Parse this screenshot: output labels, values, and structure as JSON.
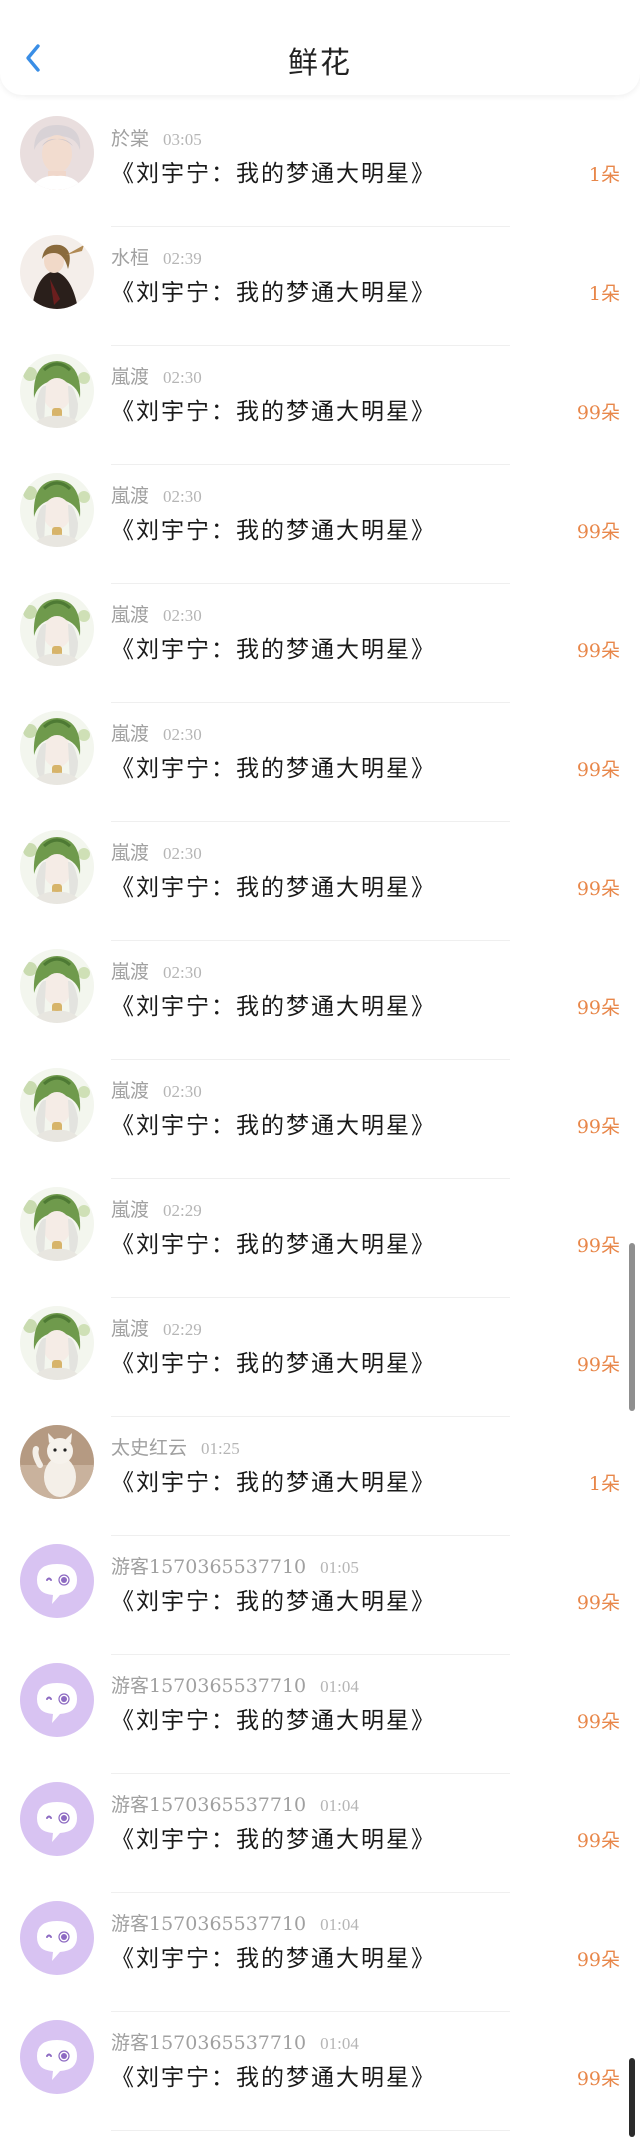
{
  "header": {
    "title": "鲜花"
  },
  "colors": {
    "accent": "#3a8ee6",
    "count": "#e8874a"
  },
  "items": [
    {
      "user": "於棠",
      "time": "03:05",
      "work": "《刘宇宁：我的梦通大明星》",
      "count": "1朵",
      "avatar": "portrait"
    },
    {
      "user": "水桓",
      "time": "02:39",
      "work": "《刘宇宁：我的梦通大明星》",
      "count": "1朵",
      "avatar": "dark-figure"
    },
    {
      "user": "嵐渡",
      "time": "02:30",
      "work": "《刘宇宁：我的梦通大明星》",
      "count": "99朵",
      "avatar": "green-hood"
    },
    {
      "user": "嵐渡",
      "time": "02:30",
      "work": "《刘宇宁：我的梦通大明星》",
      "count": "99朵",
      "avatar": "green-hood"
    },
    {
      "user": "嵐渡",
      "time": "02:30",
      "work": "《刘宇宁：我的梦通大明星》",
      "count": "99朵",
      "avatar": "green-hood"
    },
    {
      "user": "嵐渡",
      "time": "02:30",
      "work": "《刘宇宁：我的梦通大明星》",
      "count": "99朵",
      "avatar": "green-hood"
    },
    {
      "user": "嵐渡",
      "time": "02:30",
      "work": "《刘宇宁：我的梦通大明星》",
      "count": "99朵",
      "avatar": "green-hood"
    },
    {
      "user": "嵐渡",
      "time": "02:30",
      "work": "《刘宇宁：我的梦通大明星》",
      "count": "99朵",
      "avatar": "green-hood"
    },
    {
      "user": "嵐渡",
      "time": "02:30",
      "work": "《刘宇宁：我的梦通大明星》",
      "count": "99朵",
      "avatar": "green-hood"
    },
    {
      "user": "嵐渡",
      "time": "02:29",
      "work": "《刘宇宁：我的梦通大明星》",
      "count": "99朵",
      "avatar": "green-hood"
    },
    {
      "user": "嵐渡",
      "time": "02:29",
      "work": "《刘宇宁：我的梦通大明星》",
      "count": "99朵",
      "avatar": "green-hood"
    },
    {
      "user": "太史红云",
      "time": "01:25",
      "work": "《刘宇宁：我的梦通大明星》",
      "count": "1朵",
      "avatar": "cat"
    },
    {
      "user": "游客1570365537710",
      "time": "01:05",
      "work": "《刘宇宁：我的梦通大明星》",
      "count": "99朵",
      "avatar": "bubble"
    },
    {
      "user": "游客1570365537710",
      "time": "01:04",
      "work": "《刘宇宁：我的梦通大明星》",
      "count": "99朵",
      "avatar": "bubble"
    },
    {
      "user": "游客1570365537710",
      "time": "01:04",
      "work": "《刘宇宁：我的梦通大明星》",
      "count": "99朵",
      "avatar": "bubble"
    },
    {
      "user": "游客1570365537710",
      "time": "01:04",
      "work": "《刘宇宁：我的梦通大明星》",
      "count": "99朵",
      "avatar": "bubble"
    },
    {
      "user": "游客1570365537710",
      "time": "01:04",
      "work": "《刘宇宁：我的梦通大明星》",
      "count": "99朵",
      "avatar": "bubble"
    }
  ]
}
